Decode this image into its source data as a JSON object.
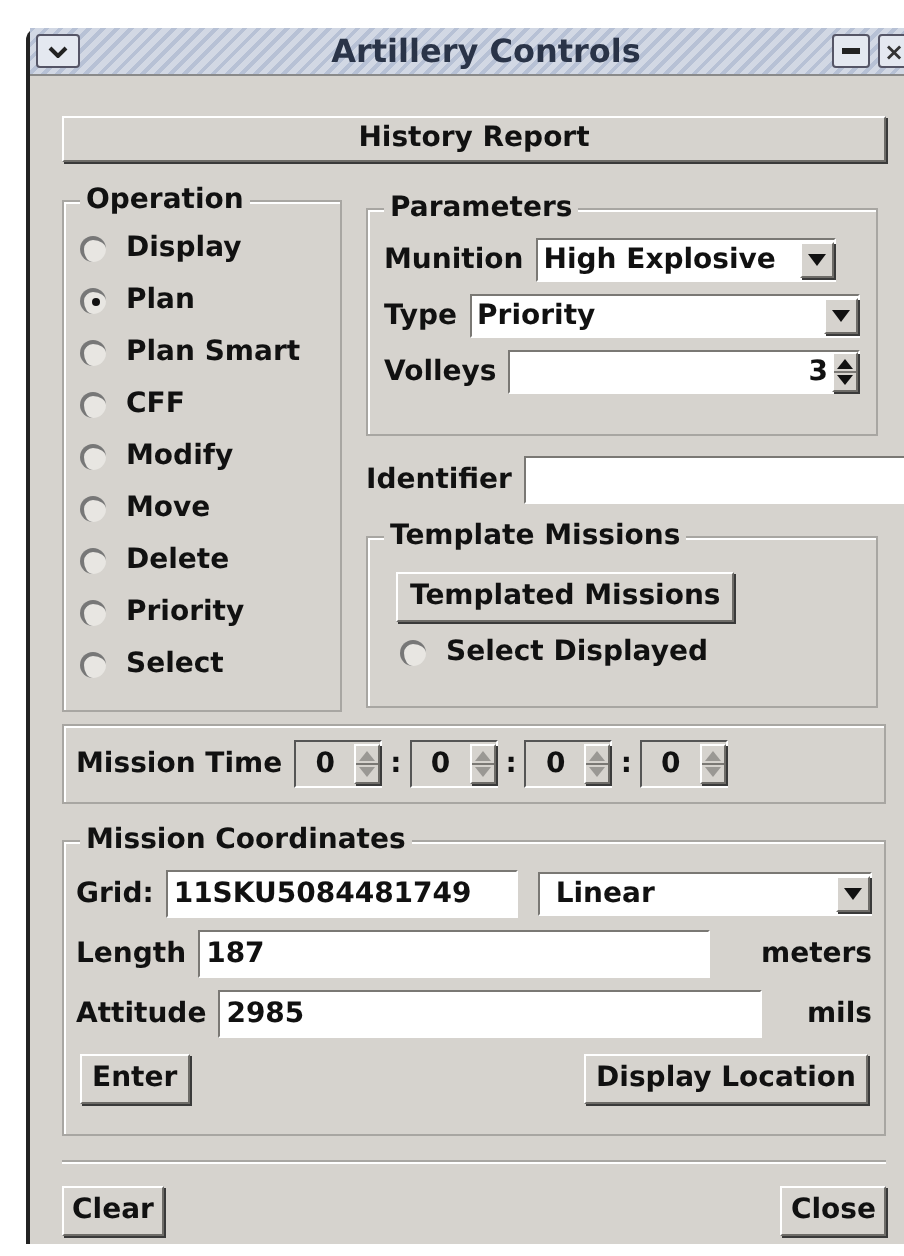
{
  "window": {
    "title": "Artillery Controls",
    "close_glyph": "×"
  },
  "history_button": "History Report",
  "operation": {
    "title": "Operation",
    "options": [
      {
        "label": "Display",
        "selected": false
      },
      {
        "label": "Plan",
        "selected": true
      },
      {
        "label": "Plan Smart",
        "selected": false
      },
      {
        "label": "CFF",
        "selected": false
      },
      {
        "label": "Modify",
        "selected": false
      },
      {
        "label": "Move",
        "selected": false
      },
      {
        "label": "Delete",
        "selected": false
      },
      {
        "label": "Priority",
        "selected": false
      },
      {
        "label": "Select",
        "selected": false
      }
    ]
  },
  "parameters": {
    "title": "Parameters",
    "munition": {
      "label": "Munition",
      "value": "High Explosive"
    },
    "type": {
      "label": "Type",
      "value": "Priority"
    },
    "volleys": {
      "label": "Volleys",
      "value": "3"
    }
  },
  "identifier": {
    "label": "Identifier"
  },
  "template_missions": {
    "title": "Template Missions",
    "button": "Templated Missions",
    "radio": {
      "label": "Select Displayed",
      "selected": false
    }
  },
  "mission_time": {
    "label": "Mission Time",
    "fields": [
      {
        "value": "0",
        "separator": ":"
      },
      {
        "value": "0",
        "separator": ":"
      },
      {
        "value": "0",
        "separator": ":"
      },
      {
        "value": "0"
      }
    ]
  },
  "mission_coordinates": {
    "title": "Mission Coordinates",
    "grid": {
      "label": "Grid:",
      "value": "11SKU5084481749",
      "mode": "Linear"
    },
    "length": {
      "label": "Length",
      "value": "187",
      "unit": "meters"
    },
    "attitude": {
      "label": "Attitude",
      "value": "2985",
      "unit": "mils"
    },
    "buttons": [
      "Enter",
      "Display Location"
    ]
  },
  "footer_buttons": [
    "Clear",
    "Close"
  ]
}
